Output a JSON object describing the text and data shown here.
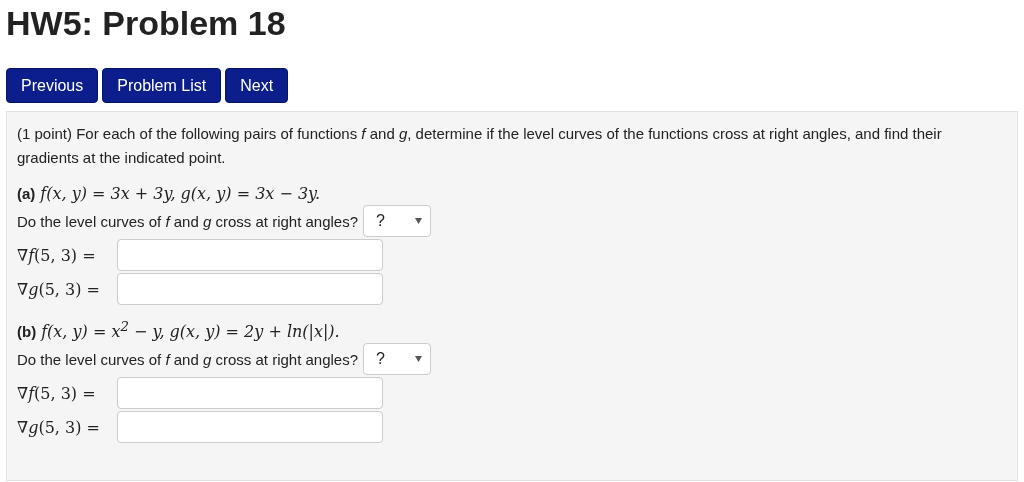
{
  "title": "HW5: Problem 18",
  "nav_buttons": [
    "Previous",
    "Problem List",
    "Next"
  ],
  "problem": {
    "intro": "(1 point) For each of the following pairs of functions *f* and *g*, determine if the level curves of the functions cross at right angles, and find their gradients at the indicated point.",
    "parts": [
      {
        "label": "(a)",
        "formula": "f(x, y) = 3x + 3y, g(x, y) = 3x − 3y.",
        "question": "Do the level curves of *f* and *g* cross at right angles?",
        "select_value": "?",
        "gradients": [
          "∇*f*(5, 3) =",
          "∇*g*(5, 3) ="
        ]
      },
      {
        "label": "(b)",
        "formula": "f(x, y) = x$^{2}$ − y, g(x, y) = 2y + ln(|x|).",
        "question": "Do the level curves of *f* and *g* cross at right angles?",
        "select_value": "?",
        "gradients": [
          "∇*f*(5, 3) =",
          "∇*g*(5, 3) ="
        ]
      }
    ]
  }
}
